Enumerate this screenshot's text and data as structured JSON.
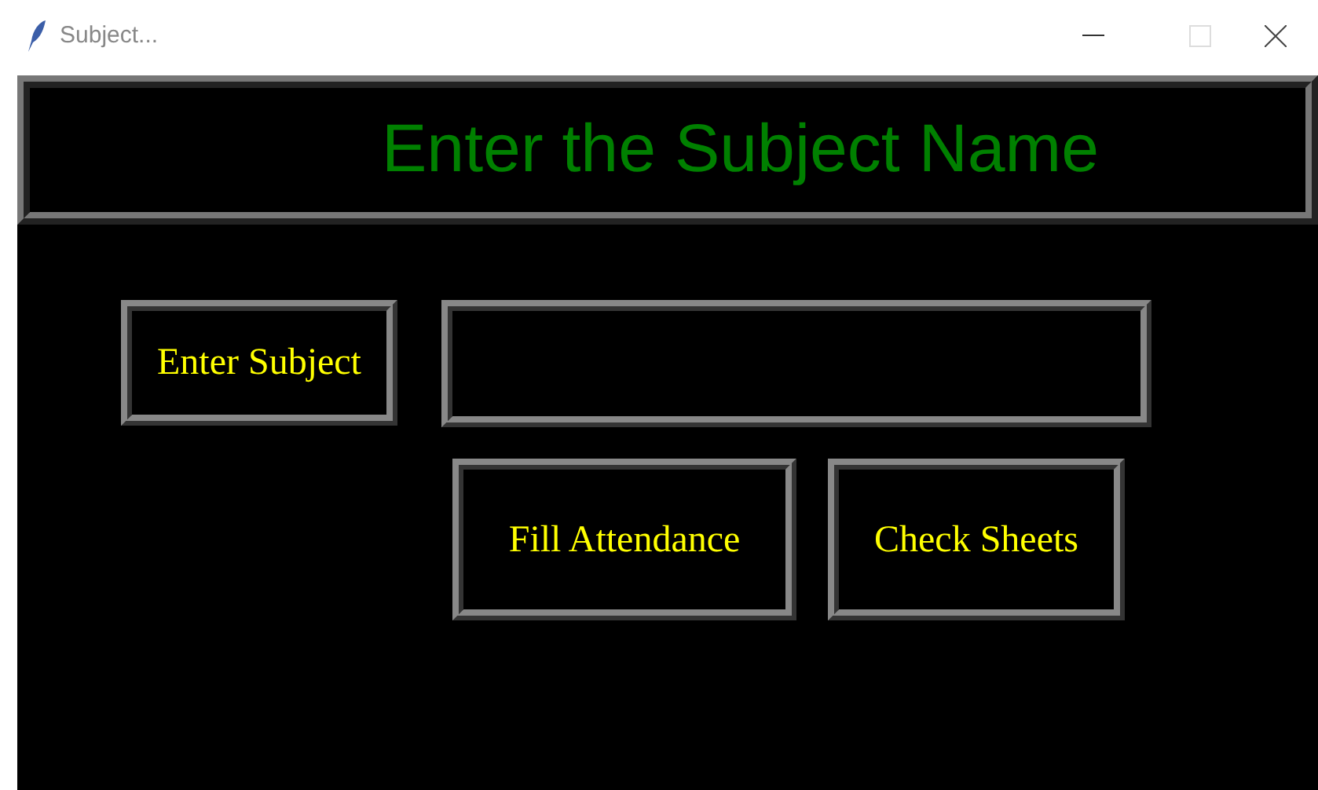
{
  "window": {
    "title": "Subject..."
  },
  "header": {
    "title": "Enter the Subject Name"
  },
  "subject_label": "Enter Subject",
  "buttons": [
    {
      "label": "Fill Attendance"
    },
    {
      "label": "Check Sheets"
    }
  ]
}
